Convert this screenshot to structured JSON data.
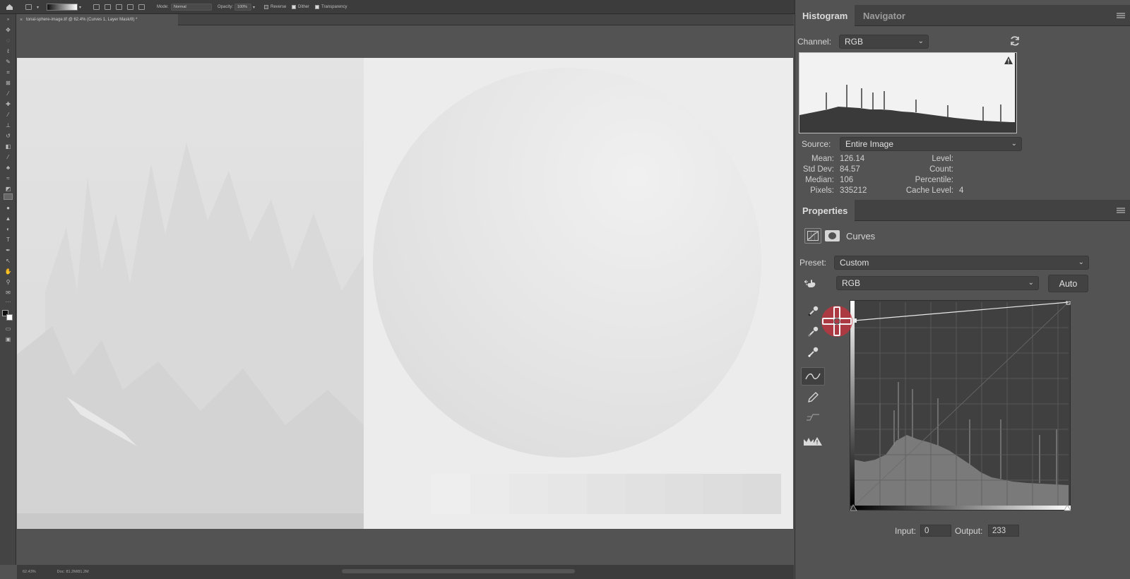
{
  "options_bar": {
    "mode_label": "Mode:",
    "mode_value": "Normal",
    "opacity_label": "Opacity:",
    "opacity_value": "100%",
    "reverse_label": "Reverse",
    "dither_label": "Dither",
    "transparency_label": "Transparency"
  },
  "document_tab": {
    "title": "tonal-sphere-image.tif @ 62.4% (Curves 1, Layer Mask/8) *"
  },
  "status_bar": {
    "zoom": "62.43%",
    "doc_info": "Doc: 81.2M/81.2M"
  },
  "histogram_panel": {
    "tabs": [
      "Histogram",
      "Navigator"
    ],
    "channel_label": "Channel:",
    "channel_value": "RGB",
    "source_label": "Source:",
    "source_value": "Entire Image",
    "stats_left": [
      {
        "label": "Mean:",
        "value": "126.14"
      },
      {
        "label": "Std Dev:",
        "value": "84.57"
      },
      {
        "label": "Median:",
        "value": "106"
      },
      {
        "label": "Pixels:",
        "value": "335212"
      }
    ],
    "stats_right": [
      {
        "label": "Level:",
        "value": ""
      },
      {
        "label": "Count:",
        "value": ""
      },
      {
        "label": "Percentile:",
        "value": ""
      },
      {
        "label": "Cache Level:",
        "value": "4"
      }
    ]
  },
  "properties_panel": {
    "title": "Properties",
    "adjustment_name": "Curves",
    "preset_label": "Preset:",
    "preset_value": "Custom",
    "channel_value": "RGB",
    "auto_label": "Auto",
    "input_label": "Input:",
    "input_value": "0",
    "output_label": "Output:",
    "output_value": "233"
  },
  "colors": {
    "panel_bg": "#535353",
    "header_bg": "#424242",
    "accent_red": "#c8323c"
  }
}
